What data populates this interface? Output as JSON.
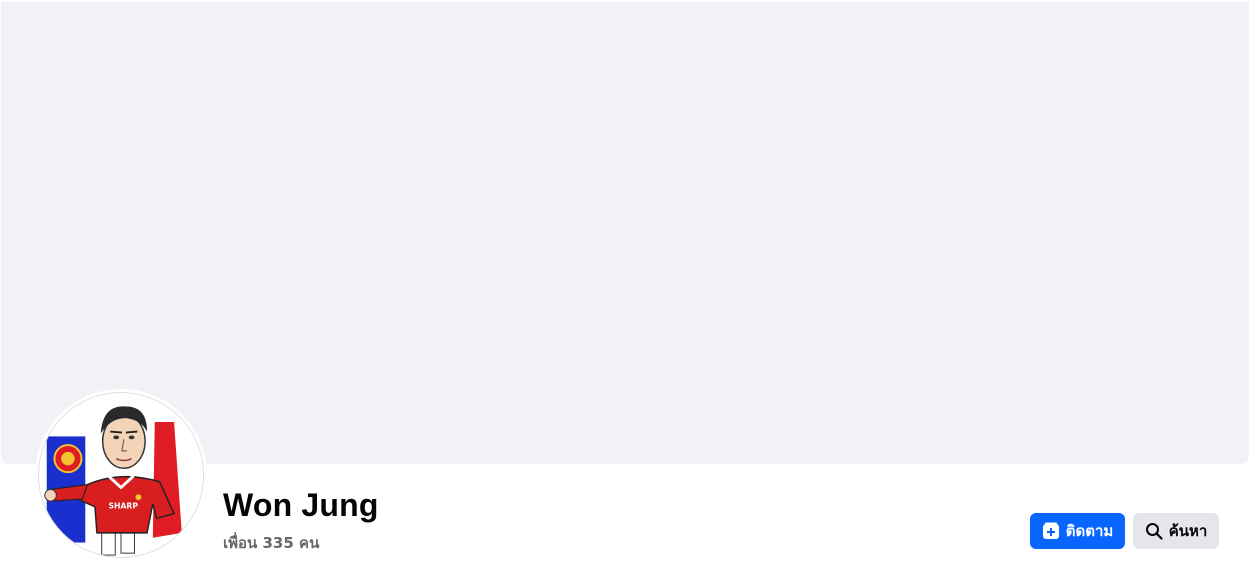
{
  "profile": {
    "name": "Won Jung",
    "friends_text": "เพื่อน 335 คน"
  },
  "actions": {
    "follow_label": "ติดตาม",
    "follow_icon": "follow-plus-icon",
    "search_label": "ค้นหา",
    "search_icon": "search-icon"
  },
  "colors": {
    "accent": "#0866ff",
    "cover_bg": "#f0f2f5",
    "secondary_button": "#e4e6eb",
    "muted_text": "#65676b"
  },
  "avatar": {
    "shirt_text": "SHARP"
  }
}
